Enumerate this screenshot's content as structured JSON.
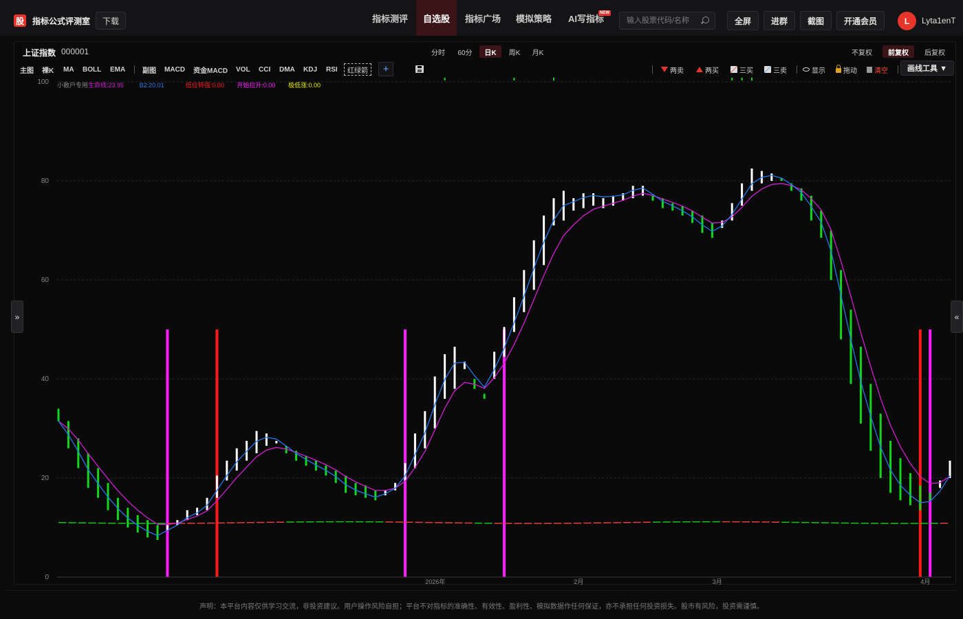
{
  "app": {
    "logo_char": "股",
    "brand": "指标公式评测室",
    "download": "下载"
  },
  "nav": {
    "items": [
      {
        "label": "指标测评"
      },
      {
        "label": "自选股"
      },
      {
        "label": "指标广场"
      },
      {
        "label": "模拟策略"
      },
      {
        "label": "AI写指标"
      }
    ],
    "new_badge": "NEW",
    "active_index": 1
  },
  "search": {
    "placeholder": "输入股票代码/名称"
  },
  "top_buttons": {
    "fullscreen": "全屏",
    "join_group": "进群",
    "screenshot": "截图",
    "vip": "开通会员"
  },
  "user": {
    "avatar_letter": "L",
    "name": "Lyta1enT"
  },
  "stock": {
    "name": "上证指数",
    "code": "000001"
  },
  "periods": [
    "分时",
    "60分",
    "日K",
    "周K",
    "月K"
  ],
  "period_active": "日K",
  "adjust": [
    "不复权",
    "前复权",
    "后复权"
  ],
  "adjust_active": "前复权",
  "indicator_tabs": {
    "main": [
      "主图",
      "裸K",
      "MA",
      "BOLL",
      "EMA"
    ],
    "sub": [
      "副图",
      "MACD",
      "资金MACD",
      "VOL",
      "CCI",
      "DMA",
      "KDJ",
      "RSI"
    ],
    "custom": "红绿箭"
  },
  "tools": {
    "two_sell": "两卖",
    "two_buy": "两买",
    "three_buy": "三买",
    "three_sell": "三卖",
    "show": "显示",
    "drag": "拖动",
    "clear": "清空",
    "draw": "画线工具 ▼"
  },
  "colors": {
    "up": "#ffffff",
    "down": "#11d81a",
    "lifeline": "#d21fd2",
    "b2": "#2478e8",
    "signal_red": "#ff1a1a",
    "signal_magenta": "#ff1aff",
    "legend_yellow": "#e8e800"
  },
  "chart_data": {
    "type": "candlestick",
    "legend": [
      {
        "label": "小散户专用",
        "color": "#8a8a8e"
      },
      {
        "label": "生命线:23.95",
        "color": "#d21fd2"
      },
      {
        "label": "B2:20.01",
        "color": "#2478e8"
      },
      {
        "label": "低位转强:0.00",
        "color": "#ff1a1a"
      },
      {
        "label": "开始拉升:0.00",
        "color": "#ff1aff"
      },
      {
        "label": "极低涨:0.00",
        "color": "#e8e800"
      }
    ],
    "ylim": [
      0,
      100
    ],
    "yticks": [
      0,
      20,
      40,
      60,
      80,
      100
    ],
    "xticks": [
      "2026年",
      "2月",
      "3月",
      "4月"
    ],
    "candles": [
      [
        34.0,
        31.5,
        34.5,
        31.2
      ],
      [
        31.5,
        26.0,
        32.0,
        25.5
      ],
      [
        28.0,
        22.0,
        28.5,
        21.5
      ],
      [
        25.0,
        18.0,
        25.5,
        17.5
      ],
      [
        22.0,
        16.0,
        22.5,
        15.5
      ],
      [
        19.0,
        13.5,
        19.5,
        13.0
      ],
      [
        16.0,
        11.5,
        16.5,
        11.0
      ],
      [
        14.0,
        10.0,
        14.5,
        9.5
      ],
      [
        12.5,
        9.0,
        13.0,
        8.5
      ],
      [
        11.5,
        8.0,
        12.0,
        7.5
      ],
      [
        10.5,
        7.5,
        11.0,
        7.0
      ],
      [
        9.5,
        10.5,
        11.0,
        9.0
      ],
      [
        10.5,
        11.5,
        12.0,
        10.0
      ],
      [
        11.5,
        13.5,
        14.0,
        11.0
      ],
      [
        12.5,
        14.0,
        14.5,
        12.0
      ],
      [
        13.5,
        16.0,
        16.5,
        13.0
      ],
      [
        16.0,
        20.5,
        21.0,
        15.5
      ],
      [
        19.5,
        23.5,
        24.0,
        19.0
      ],
      [
        21.5,
        26.0,
        26.5,
        21.0
      ],
      [
        23.5,
        27.5,
        28.0,
        23.0
      ],
      [
        25.0,
        29.5,
        30.0,
        24.5
      ],
      [
        26.5,
        29.0,
        29.5,
        26.0
      ],
      [
        27.0,
        27.5,
        28.5,
        26.5
      ],
      [
        26.5,
        25.0,
        27.0,
        24.5
      ],
      [
        25.5,
        23.5,
        26.0,
        23.0
      ],
      [
        24.5,
        22.5,
        25.0,
        22.0
      ],
      [
        23.5,
        21.5,
        24.0,
        21.0
      ],
      [
        22.5,
        20.5,
        23.0,
        20.0
      ],
      [
        21.5,
        19.0,
        22.0,
        18.5
      ],
      [
        20.5,
        17.0,
        21.0,
        16.5
      ],
      [
        19.0,
        16.5,
        19.5,
        16.0
      ],
      [
        18.5,
        16.0,
        19.0,
        15.5
      ],
      [
        17.5,
        15.5,
        18.0,
        15.0
      ],
      [
        16.5,
        17.5,
        18.0,
        16.0
      ],
      [
        17.5,
        19.0,
        19.5,
        17.0
      ],
      [
        19.5,
        23.0,
        23.5,
        19.0
      ],
      [
        22.0,
        29.0,
        29.5,
        21.5
      ],
      [
        26.0,
        33.5,
        34.0,
        25.5
      ],
      [
        30.0,
        40.5,
        41.0,
        29.5
      ],
      [
        36.0,
        45.0,
        45.5,
        35.5
      ],
      [
        38.0,
        46.5,
        47.0,
        37.5
      ],
      [
        42.0,
        43.5,
        44.0,
        41.0
      ],
      [
        40.0,
        38.0,
        40.5,
        37.5
      ],
      [
        37.0,
        36.0,
        38.0,
        35.5
      ],
      [
        40.0,
        45.5,
        46.0,
        39.5
      ],
      [
        44.5,
        50.5,
        51.0,
        44.0
      ],
      [
        49.5,
        56.5,
        57.0,
        49.0
      ],
      [
        53.5,
        62.0,
        62.5,
        53.0
      ],
      [
        58.0,
        68.0,
        68.5,
        57.5
      ],
      [
        63.0,
        73.0,
        73.5,
        62.5
      ],
      [
        71.0,
        76.5,
        77.0,
        70.5
      ],
      [
        72.0,
        78.0,
        78.5,
        71.5
      ],
      [
        74.0,
        76.5,
        77.0,
        73.5
      ],
      [
        74.5,
        77.5,
        78.0,
        74.0
      ],
      [
        75.0,
        77.5,
        78.0,
        74.5
      ],
      [
        74.5,
        76.5,
        77.0,
        74.0
      ],
      [
        75.0,
        77.0,
        77.5,
        74.5
      ],
      [
        76.0,
        77.5,
        78.0,
        75.5
      ],
      [
        76.5,
        79.0,
        79.5,
        76.0
      ],
      [
        77.0,
        79.0,
        79.5,
        76.5
      ],
      [
        77.0,
        76.0,
        77.5,
        75.5
      ],
      [
        76.5,
        74.5,
        77.0,
        74.0
      ],
      [
        75.5,
        74.0,
        76.0,
        73.5
      ],
      [
        75.0,
        73.0,
        75.5,
        72.5
      ],
      [
        74.0,
        71.5,
        74.5,
        71.0
      ],
      [
        73.0,
        69.5,
        73.5,
        69.0
      ],
      [
        71.5,
        68.5,
        72.0,
        68.0
      ],
      [
        70.5,
        72.0,
        72.5,
        70.0
      ],
      [
        72.0,
        75.5,
        76.0,
        71.5
      ],
      [
        75.0,
        79.5,
        80.0,
        74.5
      ],
      [
        78.0,
        82.5,
        83.0,
        77.5
      ],
      [
        79.5,
        82.0,
        82.5,
        79.0
      ],
      [
        80.0,
        81.5,
        82.0,
        79.5
      ],
      [
        80.5,
        80.0,
        81.0,
        79.5
      ],
      [
        79.5,
        78.0,
        80.0,
        77.5
      ],
      [
        78.5,
        76.0,
        79.0,
        75.5
      ],
      [
        77.0,
        72.0,
        77.5,
        71.5
      ],
      [
        74.0,
        68.5,
        74.5,
        68.0
      ],
      [
        70.0,
        60.0,
        70.5,
        59.5
      ],
      [
        62.0,
        48.0,
        62.5,
        47.5
      ],
      [
        54.0,
        39.0,
        54.5,
        38.5
      ],
      [
        46.5,
        31.0,
        47.0,
        30.5
      ],
      [
        39.0,
        25.5,
        39.5,
        25.0
      ],
      [
        33.0,
        20.0,
        33.5,
        19.5
      ],
      [
        27.5,
        17.0,
        28.0,
        16.5
      ],
      [
        24.0,
        15.5,
        24.5,
        15.0
      ],
      [
        21.0,
        14.5,
        21.5,
        14.0
      ],
      [
        18.5,
        13.5,
        19.0,
        13.0
      ],
      [
        17.0,
        15.5,
        17.5,
        15.0
      ],
      [
        18.0,
        19.5,
        20.0,
        17.5
      ],
      [
        20.0,
        23.5,
        24.0,
        19.5
      ]
    ],
    "signals": [
      {
        "index": 11,
        "color": "#ff1aff"
      },
      {
        "index": 16,
        "color": "#ff1a1a"
      },
      {
        "index": 35,
        "color": "#ff1aff"
      },
      {
        "index": 45,
        "color": "#ff1aff"
      },
      {
        "index": 87,
        "color": "#ff1a1a"
      },
      {
        "index": 88,
        "color": "#ff1aff"
      }
    ],
    "baseline_value": 11.0
  },
  "disclaimer": "声明：本平台内容仅供学习交流，非投资建议。用户操作风险自担；平台不对指标的准确性、有效性、盈利性、模拟数据作任何保证，亦不承担任何投资损失。股市有风险，投资需谨慎。"
}
